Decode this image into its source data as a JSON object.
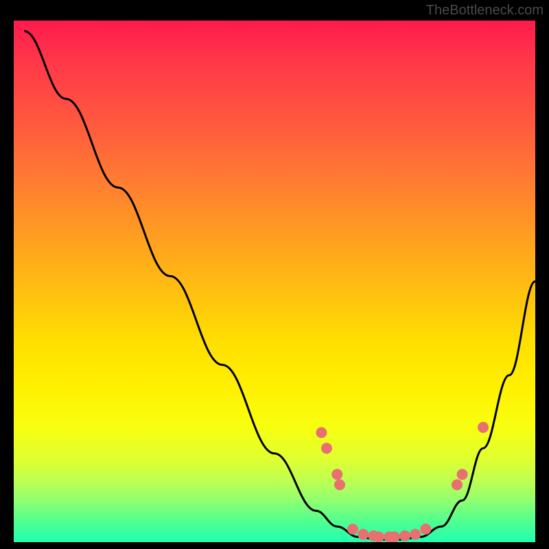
{
  "watermark": "TheBottleneck.com",
  "chart_data": {
    "type": "line",
    "title": "",
    "xlabel": "",
    "ylabel": "",
    "xlim": [
      0,
      100
    ],
    "ylim": [
      0,
      100
    ],
    "grid": false,
    "series": [
      {
        "name": "curve",
        "x": [
          2,
          10,
          20,
          30,
          40,
          50,
          58,
          62,
          66,
          70,
          74,
          78,
          82,
          86,
          90,
          95,
          100
        ],
        "y": [
          98,
          85,
          68,
          51,
          34,
          17,
          6,
          3,
          1,
          0.5,
          0.5,
          1,
          3,
          8,
          18,
          32,
          50
        ]
      }
    ],
    "markers": [
      {
        "x": 59,
        "y": 21
      },
      {
        "x": 60,
        "y": 18
      },
      {
        "x": 62,
        "y": 13
      },
      {
        "x": 62.5,
        "y": 11
      },
      {
        "x": 65,
        "y": 2.5
      },
      {
        "x": 67,
        "y": 1.5
      },
      {
        "x": 69,
        "y": 1.2
      },
      {
        "x": 70,
        "y": 1.0
      },
      {
        "x": 72,
        "y": 1.0
      },
      {
        "x": 73,
        "y": 1.0
      },
      {
        "x": 75,
        "y": 1.2
      },
      {
        "x": 77,
        "y": 1.5
      },
      {
        "x": 79,
        "y": 2.5
      },
      {
        "x": 85,
        "y": 11
      },
      {
        "x": 86,
        "y": 13
      },
      {
        "x": 90,
        "y": 22
      }
    ]
  }
}
